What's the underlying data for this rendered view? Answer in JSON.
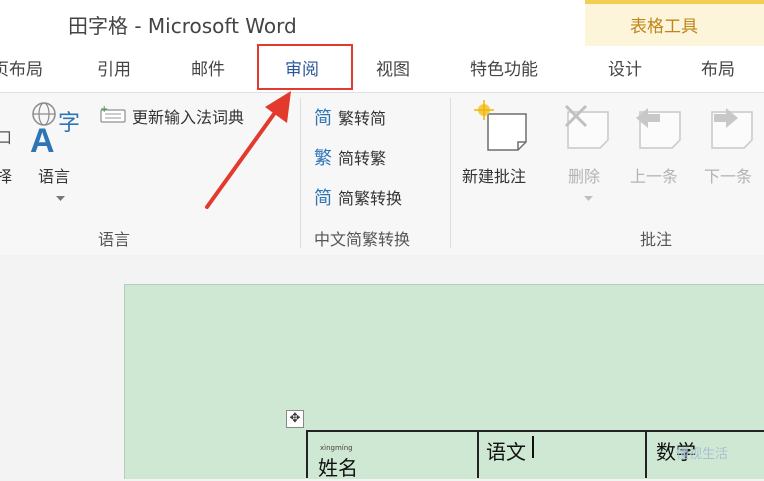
{
  "window": {
    "title": "田字格 - Microsoft Word"
  },
  "context_tab": {
    "title": "表格工具"
  },
  "tabs": [
    {
      "label": "页布局"
    },
    {
      "label": "引用"
    },
    {
      "label": "邮件"
    },
    {
      "label": "审阅"
    },
    {
      "label": "视图"
    },
    {
      "label": "特色功能"
    },
    {
      "label": "设计"
    },
    {
      "label": "布局"
    }
  ],
  "ribbon": {
    "language_group": {
      "label": "语言",
      "lang_button": "语言",
      "left_partial_1": "口",
      "left_partial_2": "择",
      "update_ime": "更新输入法词典"
    },
    "chinese_group": {
      "label": "中文简繁转换",
      "trad_to_simp": "繁转简",
      "simp_to_trad": "简转繁",
      "convert": "简繁转换"
    },
    "comments_group": {
      "label": "批注",
      "new_comment": "新建批注",
      "delete": "删除",
      "prev": "上一条",
      "next": "下一条"
    }
  },
  "document": {
    "cells": {
      "name": "姓名",
      "chinese": "语文",
      "math": "数学",
      "pinyin": "xìngmíng"
    },
    "move_handle": "✥"
  },
  "watermark": "懂视生活",
  "colors": {
    "active_tab": "#2b579a",
    "highlight": "#e23b2e",
    "context": "#f2cf53",
    "page": "#cfe8d3"
  }
}
